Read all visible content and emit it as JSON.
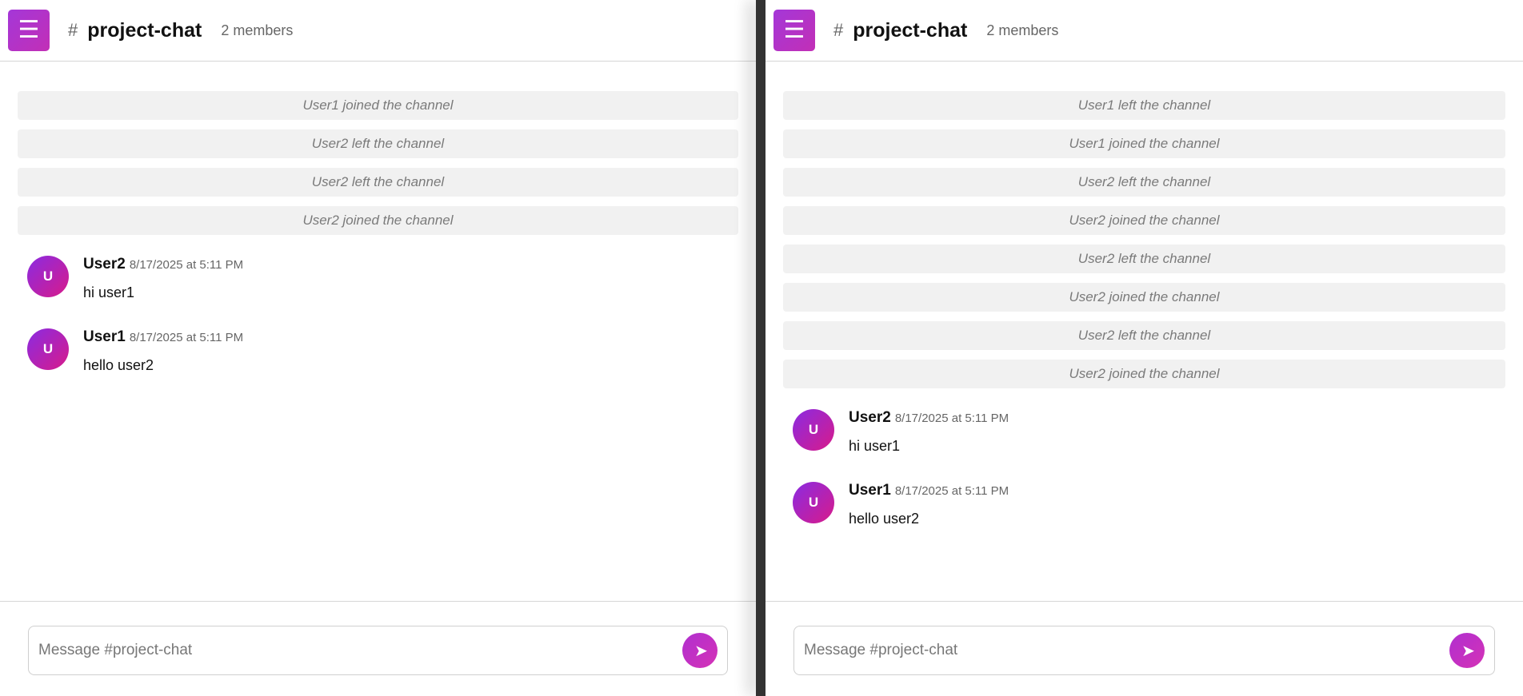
{
  "panes": [
    {
      "header": {
        "menu_icon": "☰",
        "hash": "#",
        "channel": "project-chat",
        "members": "2 members"
      },
      "system_messages": [
        "User1 joined the channel",
        "User2 left the channel",
        "User2 left the channel",
        "User2 joined the channel"
      ],
      "messages": [
        {
          "avatar": "U",
          "author": "User2",
          "time": "8/17/2025 at 5:11 PM",
          "text": "hi user1"
        },
        {
          "avatar": "U",
          "author": "User1",
          "time": "8/17/2025 at 5:11 PM",
          "text": "hello user2"
        }
      ],
      "composer": {
        "placeholder": "Message #project-chat",
        "send_icon": "➤"
      }
    },
    {
      "header": {
        "menu_icon": "☰",
        "hash": "#",
        "channel": "project-chat",
        "members": "2 members"
      },
      "system_messages": [
        "User1 left the channel",
        "User1 joined the channel",
        "User2 left the channel",
        "User2 joined the channel",
        "User2 left the channel",
        "User2 joined the channel",
        "User2 left the channel",
        "User2 joined the channel"
      ],
      "messages": [
        {
          "avatar": "U",
          "author": "User2",
          "time": "8/17/2025 at 5:11 PM",
          "text": "hi user1"
        },
        {
          "avatar": "U",
          "author": "User1",
          "time": "8/17/2025 at 5:11 PM",
          "text": "hello user2"
        }
      ],
      "composer": {
        "placeholder": "Message #project-chat",
        "send_icon": "➤"
      }
    }
  ],
  "colors": {
    "accent_start": "#a437d8",
    "accent_end": "#c22fb6",
    "system_bg": "#f1f1f1",
    "divider": "#333333"
  }
}
